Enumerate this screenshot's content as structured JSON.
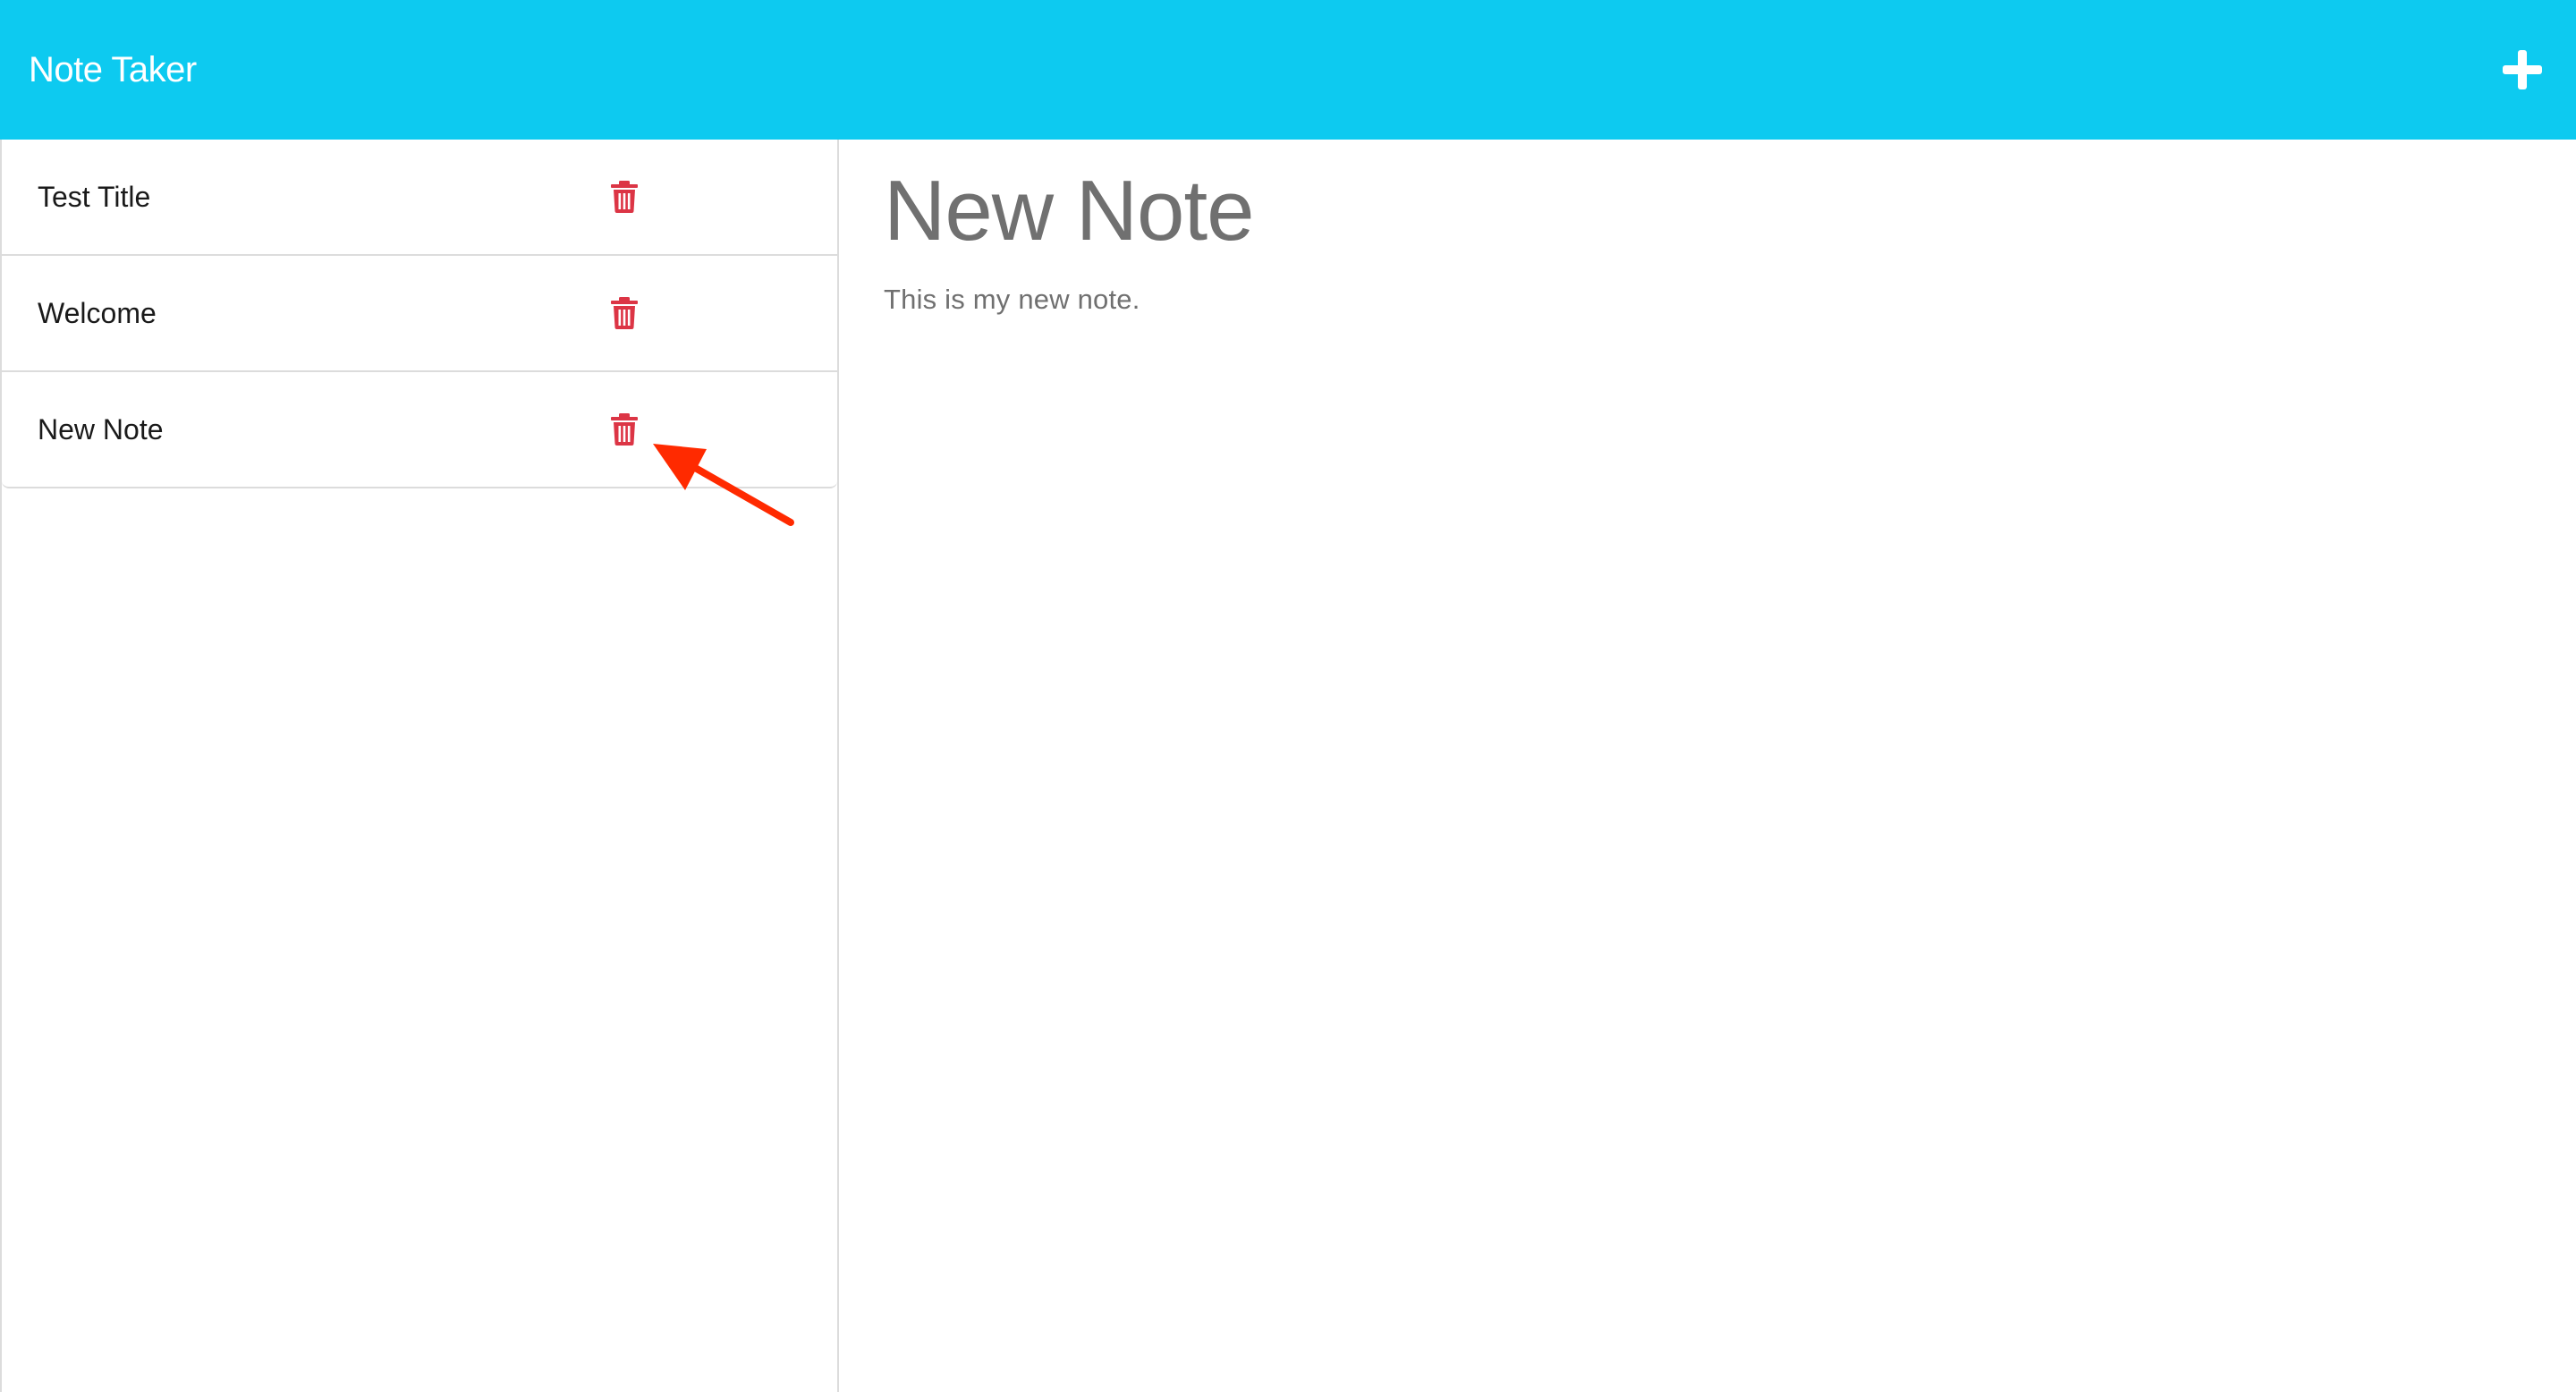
{
  "app": {
    "title": "Note Taker",
    "brand_color": "#0dcaf0"
  },
  "header": {
    "add_icon": "plus-icon"
  },
  "notes": [
    {
      "title": "Test Title",
      "delete_icon": "trash-icon"
    },
    {
      "title": "Welcome",
      "delete_icon": "trash-icon"
    },
    {
      "title": "New Note",
      "delete_icon": "trash-icon"
    }
  ],
  "active_note": {
    "title": "New Note",
    "text": "This is my new note."
  },
  "colors": {
    "delete": "#dc3545",
    "annotation_arrow": "#ff2a00",
    "muted_text": "#707070"
  }
}
